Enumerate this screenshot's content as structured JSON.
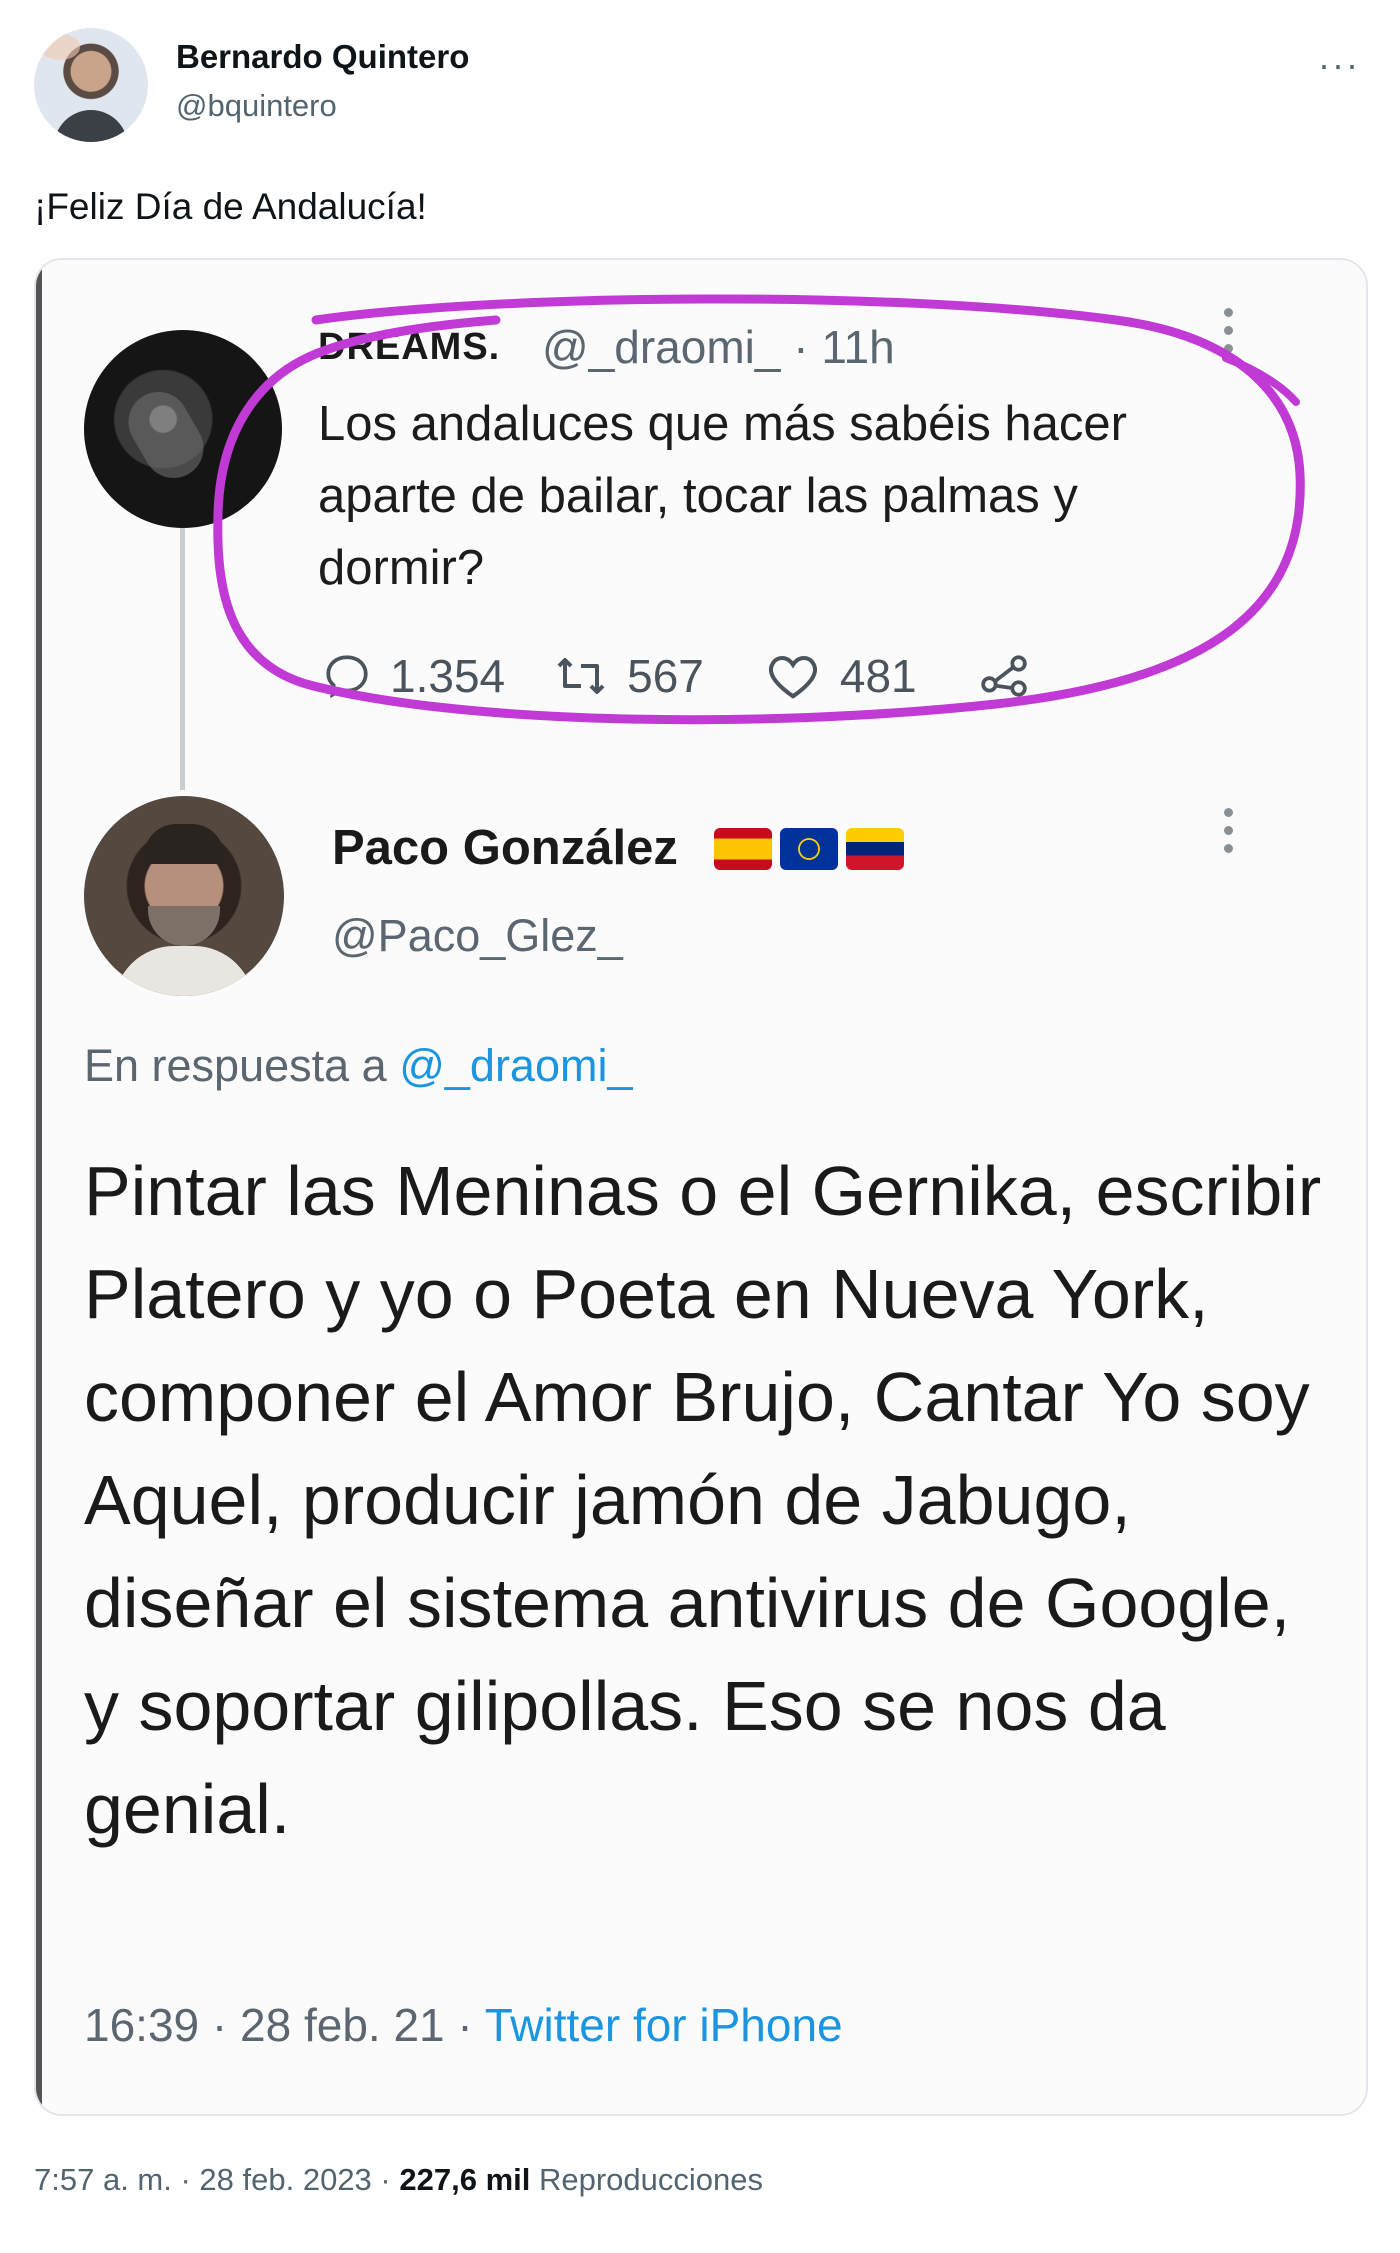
{
  "tweet": {
    "author_name": "Bernardo Quintero",
    "author_handle": "@bquintero",
    "more_label": "···",
    "text": "¡Feliz Día de Andalucía!",
    "time": "7:57 a. m.",
    "date": "28 feb. 2023",
    "views_count": "227,6 mil",
    "views_label": "Reproducciones",
    "sep": " · "
  },
  "embedded": {
    "quoted": {
      "name": "DREAMS.",
      "handle": "@_draomi_ · 11h",
      "text": "Los andaluces que más sabéis hacer aparte de bailar, tocar las palmas y dormir?",
      "replies": "1.354",
      "retweets": "567",
      "likes": "481"
    },
    "reply": {
      "name": "Paco González",
      "handle": "@Paco_Glez_",
      "reply_prefix": "En respuesta a ",
      "reply_to": "@_draomi_",
      "text": "Pintar las Meninas o el Gernika, escribir Platero y yo o Poeta en Nueva York, componer el Amor Brujo, Cantar Yo soy Aquel, producir jamón de Jabugo, diseñar el sistema antivirus de Google, y soportar gilipollas. Eso se nos da genial.",
      "time": "16:39",
      "date": "28 feb. 21",
      "source": "Twitter for iPhone",
      "sep": " · "
    }
  },
  "icons": {
    "reply": "reply-icon",
    "retweet": "retweet-icon",
    "like": "heart-icon",
    "share": "share-icon"
  },
  "colors": {
    "annotation": "#c23ad6",
    "link": "#1b95e0",
    "muted": "#536471"
  }
}
